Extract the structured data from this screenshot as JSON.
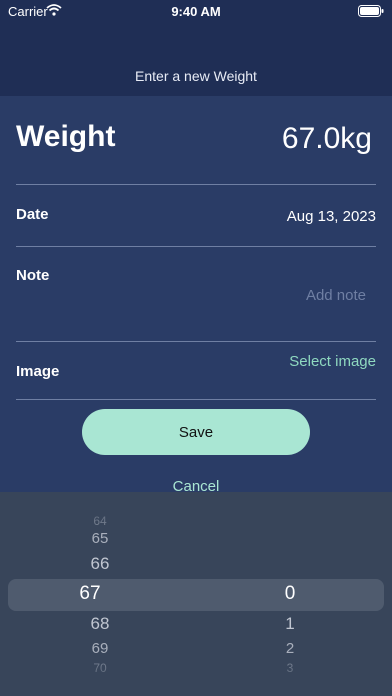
{
  "status": {
    "carrier": "Carrier",
    "time": "9:40 AM"
  },
  "nav": {
    "title": "Enter a new Weight"
  },
  "weight": {
    "label": "Weight",
    "value": "67.0kg"
  },
  "date": {
    "label": "Date",
    "value": "Aug 13, 2023"
  },
  "note": {
    "label": "Note",
    "placeholder": "Add note"
  },
  "image": {
    "label": "Image",
    "select_label": "Select image"
  },
  "buttons": {
    "save": "Save",
    "cancel": "Cancel"
  },
  "picker": {
    "whole_items": [
      "64",
      "65",
      "66",
      "67",
      "68",
      "69",
      "70"
    ],
    "whole_selected": "67",
    "decimal_items": [
      "0",
      "1",
      "2",
      "3"
    ],
    "decimal_selected": "0"
  },
  "colors": {
    "background": "#27385f",
    "accent": "#a9e6d3",
    "link": "#8fd9c0",
    "picker_bg": "#38455a"
  }
}
